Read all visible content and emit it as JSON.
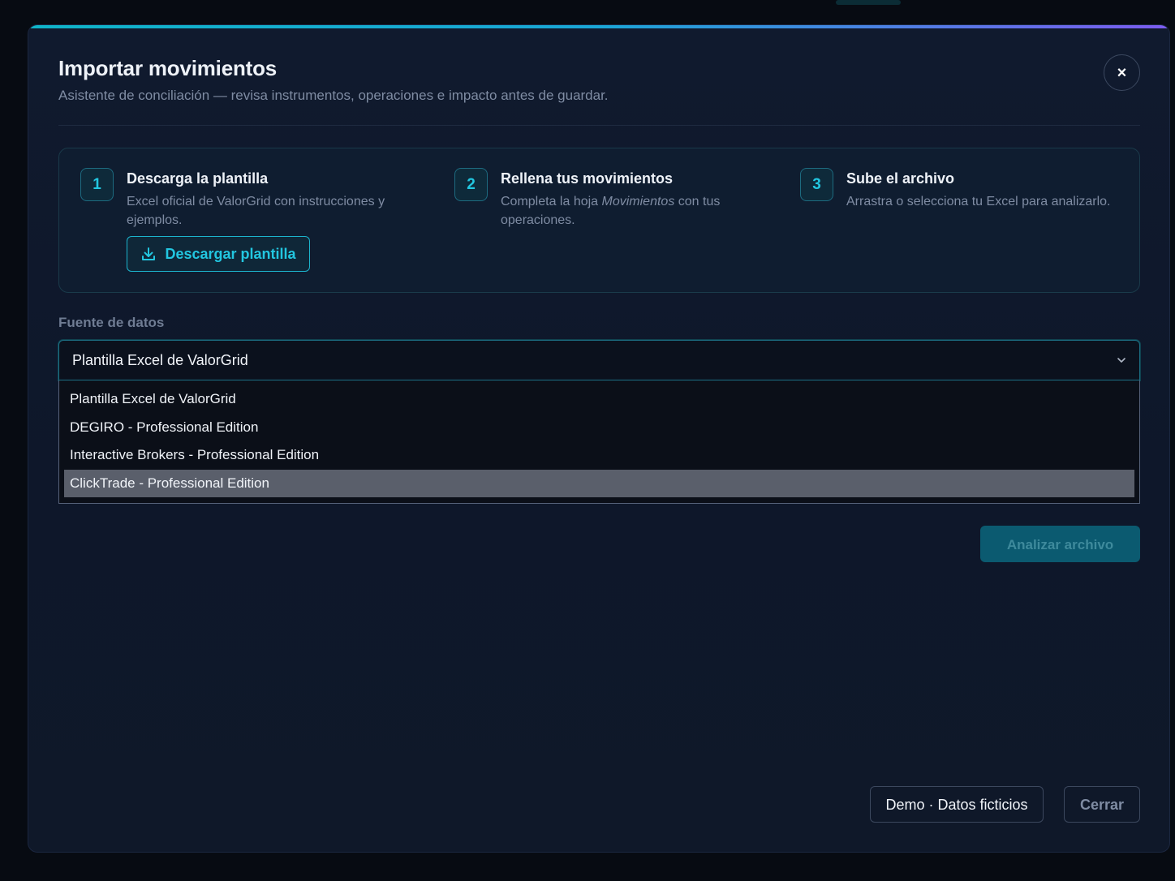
{
  "modal": {
    "title": "Importar movimientos",
    "subtitle": "Asistente de conciliación — revisa instrumentos, operaciones e impacto antes de guardar.",
    "close_glyph": "×"
  },
  "steps": [
    {
      "number": "1",
      "title": "Descarga la plantilla",
      "description": "Excel oficial de ValorGrid con instrucciones y ejemplos.",
      "button_label": "Descargar plantilla",
      "button_icon": "download-icon"
    },
    {
      "number": "2",
      "title": "Rellena tus movimientos",
      "description_before": "Completa la hoja ",
      "description_emphasis": "Movimientos",
      "description_after": " con tus operaciones."
    },
    {
      "number": "3",
      "title": "Sube el archivo",
      "description": "Arrastra o selecciona tu Excel para analizarlo."
    }
  ],
  "source": {
    "label": "Fuente de datos",
    "selected_value": "Plantilla Excel de ValorGrid",
    "chevron_icon": "chevron-down-icon",
    "options": [
      "Plantilla Excel de ValorGrid",
      "DEGIRO - Professional Edition",
      "Interactive Brokers - Professional Edition",
      "ClickTrade - Professional Edition"
    ],
    "highlighted_option": "ClickTrade - Professional Edition"
  },
  "actions": {
    "analyze_label": "Analizar archivo"
  },
  "footer": {
    "demo_label": "Demo · Datos ficticios",
    "close_label": "Cerrar"
  },
  "colors": {
    "accent": "#22c6e0",
    "modal_background": "#0e172a",
    "highlight": "#5a5f6b"
  }
}
